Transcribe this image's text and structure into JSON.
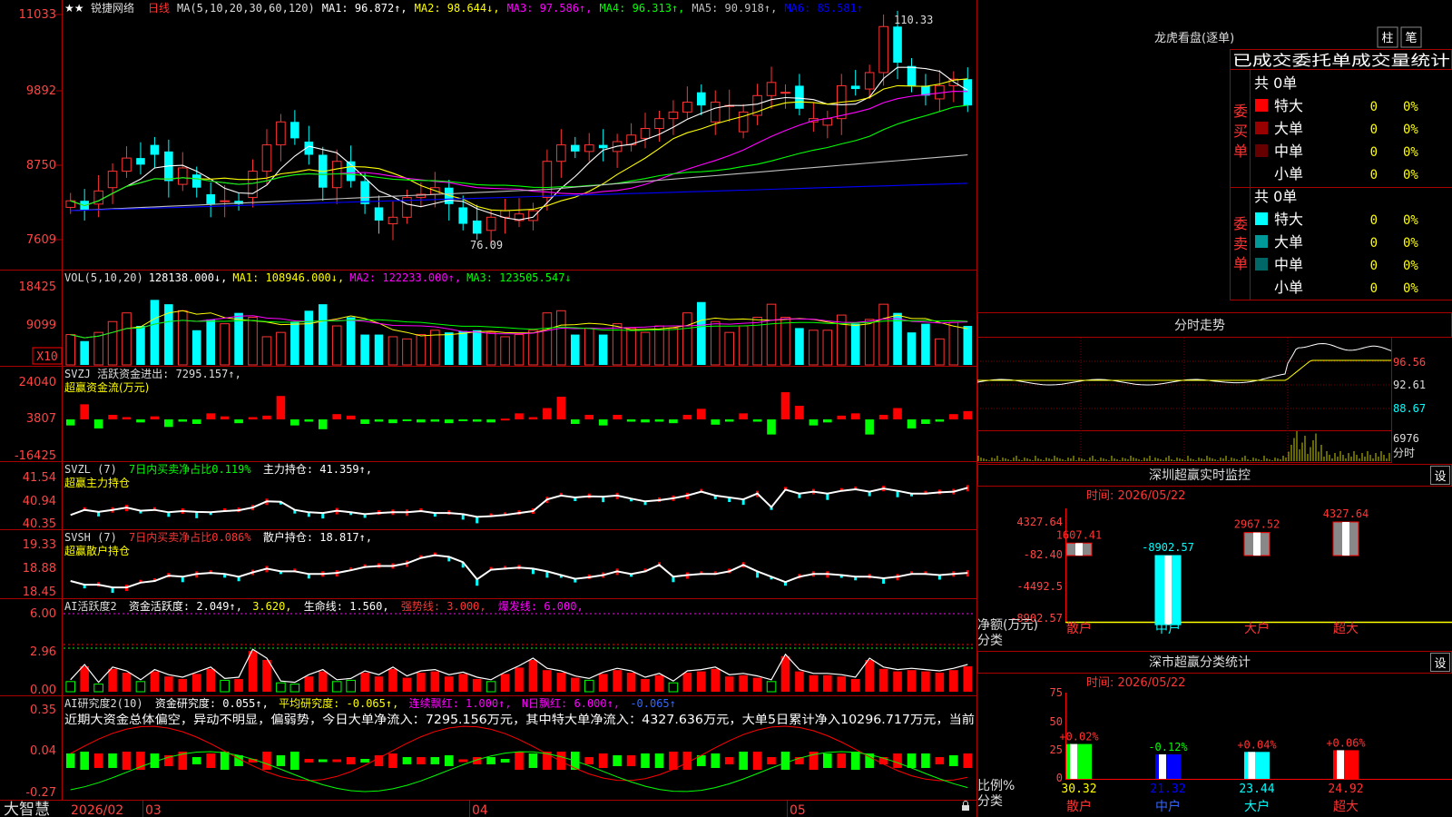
{
  "header": {
    "stars": "★★",
    "stock_name": "锐捷网络",
    "period": "日线",
    "ma_label": "MA(5,10,20,30,60,120)",
    "ma_values": [
      {
        "text": "MA1: 96.872↑,",
        "color": "#ffffff"
      },
      {
        "text": "MA2: 98.644↓,",
        "color": "#ffff00"
      },
      {
        "text": "MA3: 97.586↑,",
        "color": "#ff00ff"
      },
      {
        "text": "MA4: 96.313↑,",
        "color": "#00ff00"
      },
      {
        "text": "MA5: 90.918↑,",
        "color": "#c0c0c0"
      },
      {
        "text": "MA6: 85.581↑",
        "color": "#0000ff"
      }
    ]
  },
  "price_axis": [
    "11033",
    "9892",
    "8750",
    "7609"
  ],
  "annotations": {
    "high": "110.33",
    "low": "76.09"
  },
  "vol_panel": {
    "axis": [
      "18425",
      "9099"
    ],
    "scale_badge": "X10",
    "items": [
      {
        "text": "VOL(5,10,20)",
        "color": "#dddddd"
      },
      {
        "text": "128138.000↓,",
        "color": "#ffffff"
      },
      {
        "text": "MA1: 108946.000↓,",
        "color": "#ffff00"
      },
      {
        "text": "MA2: 122233.000↑,",
        "color": "#ff00ff"
      },
      {
        "text": "MA3: 123505.547↓",
        "color": "#00ff00"
      }
    ]
  },
  "svzj_panel": {
    "axis": [
      "24040",
      "3807",
      "-16425"
    ],
    "line1": "SVZJ  活跃资金进出: 7295.157↑,",
    "line2": "超赢资金流(万元)"
  },
  "svzl_panel": {
    "axis": [
      "41.54",
      "40.94",
      "40.35"
    ],
    "name": "SVZL (7)",
    "ratio": "7日内买卖净占比0.119%",
    "holding": "主力持仓: 41.359↑,",
    "line2": "超赢主力持仓"
  },
  "svsh_panel": {
    "axis": [
      "19.33",
      "18.88",
      "18.45"
    ],
    "name": "SVSH (7)",
    "ratio": "7日内买卖净占比0.086%",
    "holding": "散户持仓: 18.817↑,",
    "line2": "超赢散户持仓"
  },
  "ai_active_panel": {
    "axis": [
      "6.00",
      "2.96",
      "0.00"
    ],
    "name": "AI活跃度2",
    "activity": "资金活跃度: 2.049↑,",
    "value2": "3.620,",
    "life": "生命线: 1.560,",
    "strong": "强势线: 3.000,",
    "burst": "爆发线: 6.000,"
  },
  "ai_research_panel": {
    "axis": [
      "0.35",
      "0.04",
      "-0.27"
    ],
    "name": "AI研究度2(10)",
    "research": "资金研究度: 0.055↑,",
    "avg": "平均研究度: -0.065↑,",
    "streak": "连续飘红: 1.000↑,",
    "n_days": "N日飘红: 6.000↑,",
    "last": "-0.065↑",
    "commentary": "近期大资金总体偏空，异动不明显，偏弱势，今日大单净流入：7295.156万元，其中特大单净流入：4327.636万元，大单5日累计净入10296.717万元，当前"
  },
  "bottom_bar": {
    "brand": "大智慧",
    "dates": [
      "2026/02",
      "03",
      "04",
      "05"
    ]
  },
  "dragon": {
    "title": "龙虎看盘(逐单)",
    "btn1": "柱",
    "btn2": "笔",
    "tabs": "已成交委托单成交量统计",
    "buy_side": "委买单",
    "sell_side": "委卖单",
    "buy_total": "共 0单",
    "sell_total": "共 0单",
    "buy_rows": [
      {
        "label": "特大",
        "count": "0",
        "pct": "0%",
        "color": "#ff0000"
      },
      {
        "label": "大单",
        "count": "0",
        "pct": "0%",
        "color": "#990000"
      },
      {
        "label": "中单",
        "count": "0",
        "pct": "0%",
        "color": "#660000"
      },
      {
        "label": "小单",
        "count": "0",
        "pct": "0%",
        "color": ""
      }
    ],
    "sell_rows": [
      {
        "label": "特大",
        "count": "0",
        "pct": "0%",
        "color": "#00ffff"
      },
      {
        "label": "大单",
        "count": "0",
        "pct": "0%",
        "color": "#009999"
      },
      {
        "label": "中单",
        "count": "0",
        "pct": "0%",
        "color": "#006666"
      },
      {
        "label": "小单",
        "count": "0",
        "pct": "0%",
        "color": ""
      }
    ]
  },
  "intraday": {
    "title": "分时走势",
    "axis": [
      "96.56",
      "92.61",
      "88.67"
    ],
    "vol_value": "6976",
    "vol_label": "分时"
  },
  "monitor": {
    "title": "深圳超赢实时监控",
    "set": "设",
    "time": "时间: 2026/05/22",
    "axis": [
      "4327.64",
      "-82.40",
      "-4492.5",
      "-8902.57"
    ],
    "axis_label": "净额(万元)",
    "cat_label": "分类",
    "bars": [
      {
        "cat": "散户",
        "value": "1607.41"
      },
      {
        "cat": "中户",
        "value": "-8902.57"
      },
      {
        "cat": "大户",
        "value": "2967.52"
      },
      {
        "cat": "超大",
        "value": "4327.64"
      }
    ]
  },
  "classify": {
    "title": "深市超赢分类统计",
    "set": "设",
    "time": "时间: 2026/05/22",
    "axis": [
      "75",
      "50",
      "25",
      "0"
    ],
    "axis_label": "比例%",
    "cat_label": "分类",
    "bars": [
      {
        "cat": "散户",
        "change": "+0.02%",
        "value": "30.32"
      },
      {
        "cat": "中户",
        "change": "-0.12%",
        "value": "21.32"
      },
      {
        "cat": "大户",
        "change": "+0.04%",
        "value": "23.44"
      },
      {
        "cat": "超大",
        "change": "+0.06%",
        "value": "24.92"
      }
    ]
  },
  "chart_data": [
    {
      "type": "candlestick",
      "title": "锐捷网络 日线",
      "ylim": [
        76.09,
        110.33
      ],
      "yticks": [
        110.33,
        98.92,
        87.5,
        76.09
      ],
      "high": 110.33,
      "low": 76.09,
      "close": [
        82.0,
        80.5,
        83.5,
        86.5,
        88.5,
        87.5,
        89.0,
        85.0,
        87.0,
        84.0,
        81.5,
        82.0,
        81.5,
        86.5,
        90.5,
        94.0,
        91.5,
        89.0,
        84.0,
        88.0,
        85.0,
        81.5,
        79.0,
        79.5,
        82.5,
        83.0,
        84.0,
        81.5,
        78.5,
        77.0,
        79.5,
        80.5,
        80.0,
        80.5,
        88.0,
        90.5,
        89.5,
        90.5,
        90.0,
        91.0,
        92.0,
        93.0,
        94.5,
        95.5,
        97.0,
        96.5,
        97.0,
        96.5,
        95.5,
        98.0,
        100.0,
        98.5,
        96.0,
        94.5,
        94.5,
        99.5,
        99.0,
        101.5,
        108.5,
        103.0,
        99.5,
        98.0,
        99.5,
        100.5,
        96.5
      ],
      "open": [
        81.0,
        82.0,
        81.5,
        84.0,
        86.5,
        88.5,
        90.5,
        89.5,
        84.5,
        86.0,
        83.0,
        82.0,
        82.0,
        82.5,
        86.5,
        90.5,
        94.0,
        91.0,
        89.0,
        84.0,
        88.0,
        85.0,
        81.0,
        78.5,
        79.5,
        82.5,
        83.0,
        84.0,
        81.0,
        79.0,
        77.5,
        79.5,
        79.0,
        79.0,
        82.5,
        88.0,
        90.5,
        89.5,
        90.5,
        89.5,
        90.5,
        91.5,
        93.0,
        94.5,
        95.5,
        98.5,
        94.0,
        96.5,
        92.5,
        95.0,
        98.0,
        98.5,
        99.5,
        94.0,
        93.5,
        94.5,
        99.5,
        99.0,
        101.5,
        108.5,
        102.5,
        99.5,
        97.5,
        99.5,
        100.5
      ]
    },
    {
      "type": "bar",
      "title": "VOL(5,10,20)",
      "ylim": [
        0,
        18425
      ],
      "yticks": [
        18425,
        9099
      ],
      "values": [
        7000,
        5500,
        7500,
        10000,
        12000,
        9000,
        15000,
        14000,
        12500,
        8000,
        10500,
        9500,
        12000,
        11000,
        6500,
        7500,
        10000,
        12500,
        14000,
        9000,
        11000,
        7000,
        7000,
        6500,
        6000,
        7000,
        8000,
        7500,
        7800,
        8000,
        7500,
        6500,
        7000,
        8000,
        12000,
        12500,
        7000,
        8500,
        7000,
        9500,
        8500,
        7500,
        9000,
        8500,
        12000,
        14500,
        10000,
        7500,
        9000,
        11000,
        14000,
        11000,
        8500,
        8000,
        8000,
        11500,
        9500,
        10500,
        14000,
        12000,
        7500,
        9500,
        6000,
        9800,
        9000
      ]
    },
    {
      "type": "bar",
      "title": "SVZJ 活跃资金进出",
      "ylim": [
        -16425,
        24040
      ],
      "yticks": [
        24040,
        3807,
        -16425
      ],
      "values": [
        -4000,
        10000,
        -6000,
        3000,
        1500,
        -2000,
        2000,
        -5000,
        -1500,
        -3000,
        4000,
        2000,
        -2500,
        1500,
        2500,
        15500,
        -4000,
        -1500,
        -6500,
        3500,
        2500,
        -3000,
        -1500,
        -2500,
        -1000,
        -2000,
        -1500,
        -2500,
        -500,
        -1500,
        -2000,
        500,
        4000,
        1500,
        7500,
        15000,
        -3000,
        3000,
        -4000,
        3000,
        -1500,
        -2000,
        -1500,
        -2500,
        3000,
        7000,
        -3500,
        -1500,
        4000,
        -1500,
        -10000,
        18000,
        9000,
        -4000,
        -2000,
        2500,
        4000,
        -10000,
        3000,
        7500,
        -6000,
        -3000,
        -1500,
        3500,
        5500
      ]
    },
    {
      "type": "line",
      "title": "SVZL 主力持仓",
      "ylim": [
        40.35,
        41.54
      ],
      "yticks": [
        41.54,
        40.94,
        40.35
      ],
      "values": [
        40.6,
        40.73,
        40.68,
        40.73,
        40.79,
        40.71,
        40.73,
        40.67,
        40.7,
        40.68,
        40.67,
        40.7,
        40.72,
        40.79,
        40.95,
        40.94,
        40.73,
        40.67,
        40.65,
        40.71,
        40.67,
        40.62,
        40.65,
        40.67,
        40.67,
        40.7,
        40.65,
        40.65,
        40.62,
        40.55,
        40.57,
        40.6,
        40.65,
        40.7,
        41.0,
        41.1,
        41.05,
        41.08,
        41.07,
        41.1,
        41.02,
        40.95,
        40.98,
        41.03,
        41.1,
        41.2,
        41.1,
        41.05,
        41.0,
        41.15,
        40.8,
        41.25,
        41.15,
        41.2,
        41.15,
        41.22,
        41.26,
        41.2,
        41.28,
        41.22,
        41.15,
        41.15,
        41.18,
        41.2,
        41.3
      ]
    },
    {
      "type": "line",
      "title": "SVSH 散户持仓",
      "ylim": [
        18.45,
        19.33
      ],
      "yticks": [
        19.33,
        18.88,
        18.45
      ],
      "values": [
        18.67,
        18.6,
        18.6,
        18.55,
        18.55,
        18.64,
        18.67,
        18.77,
        18.75,
        18.8,
        18.82,
        18.8,
        18.75,
        18.83,
        18.9,
        18.85,
        18.85,
        18.8,
        18.8,
        18.82,
        18.87,
        18.93,
        18.95,
        18.95,
        19.0,
        19.1,
        19.15,
        19.12,
        19.02,
        18.7,
        18.88,
        18.9,
        18.92,
        18.9,
        18.85,
        18.78,
        18.71,
        18.74,
        18.78,
        18.85,
        18.8,
        18.85,
        18.97,
        18.75,
        18.78,
        18.8,
        18.8,
        18.85,
        18.97,
        18.85,
        18.75,
        18.65,
        18.75,
        18.8,
        18.8,
        18.78,
        18.75,
        18.75,
        18.72,
        18.75,
        18.8,
        18.8,
        18.78,
        18.8,
        18.82
      ]
    },
    {
      "type": "bar",
      "title": "AI活跃度2 资金活跃度",
      "ylim": [
        0,
        6
      ],
      "yticks": [
        6.0,
        2.96,
        0.0
      ],
      "values": [
        0.8,
        2.0,
        0.6,
        1.8,
        1.5,
        0.8,
        1.6,
        1.2,
        1.0,
        1.4,
        1.8,
        0.9,
        1.0,
        3.2,
        2.5,
        0.7,
        0.6,
        1.2,
        1.6,
        0.8,
        0.9,
        1.5,
        1.2,
        1.8,
        1.1,
        1.5,
        1.6,
        1.2,
        1.4,
        1.0,
        0.8,
        1.4,
        1.9,
        2.5,
        1.7,
        1.5,
        1.1,
        0.9,
        1.4,
        1.7,
        1.5,
        1.0,
        1.3,
        0.7,
        1.5,
        1.6,
        1.8,
        1.2,
        1.3,
        1.1,
        0.8,
        2.8,
        1.6,
        1.3,
        1.3,
        1.2,
        1.0,
        2.5,
        1.8,
        1.6,
        1.7,
        1.6,
        1.5,
        1.7,
        2.0
      ]
    },
    {
      "type": "bar",
      "title": "AI研究度2(10) 资金研究度",
      "ylim": [
        -0.27,
        0.35
      ],
      "yticks": [
        0.35,
        0.04,
        -0.27
      ],
      "values": [
        0.04,
        0.05,
        0.04,
        0.04,
        0.05,
        0.05,
        0.04,
        0.03,
        0.05,
        0.02,
        0.04,
        0.05,
        0.03,
        0.01,
        0.05,
        0.03,
        0.05,
        0.01,
        0.0,
        0.0,
        0.02,
        0.01,
        0.03,
        0.04,
        0.02,
        0.02,
        0.02,
        0.03,
        0.0,
        0.02,
        0.02,
        0.01,
        0.05,
        0.04,
        0.05,
        0.05,
        0.05,
        0.02,
        0.04,
        0.03,
        0.03,
        0.04,
        0.04,
        0.05,
        0.05,
        0.03,
        0.04,
        0.02,
        0.05,
        0.05,
        0.02,
        0.05,
        0.02,
        0.05,
        0.04,
        0.04,
        0.05,
        0.04,
        0.02,
        0.04,
        0.04,
        0.04,
        0.02,
        0.03,
        0.04
      ]
    },
    {
      "type": "bar",
      "title": "深圳超赢实时监控",
      "categories": [
        "散户",
        "中户",
        "大户",
        "超大"
      ],
      "values": [
        1607.41,
        -8902.57,
        2967.52,
        4327.64
      ],
      "ylim": [
        -8902.57,
        4327.64
      ]
    },
    {
      "type": "bar",
      "title": "深市超赢分类统计",
      "categories": [
        "散户",
        "中户",
        "大户",
        "超大"
      ],
      "values": [
        30.32,
        21.32,
        23.44,
        24.92
      ],
      "ylim": [
        0,
        75
      ]
    }
  ]
}
